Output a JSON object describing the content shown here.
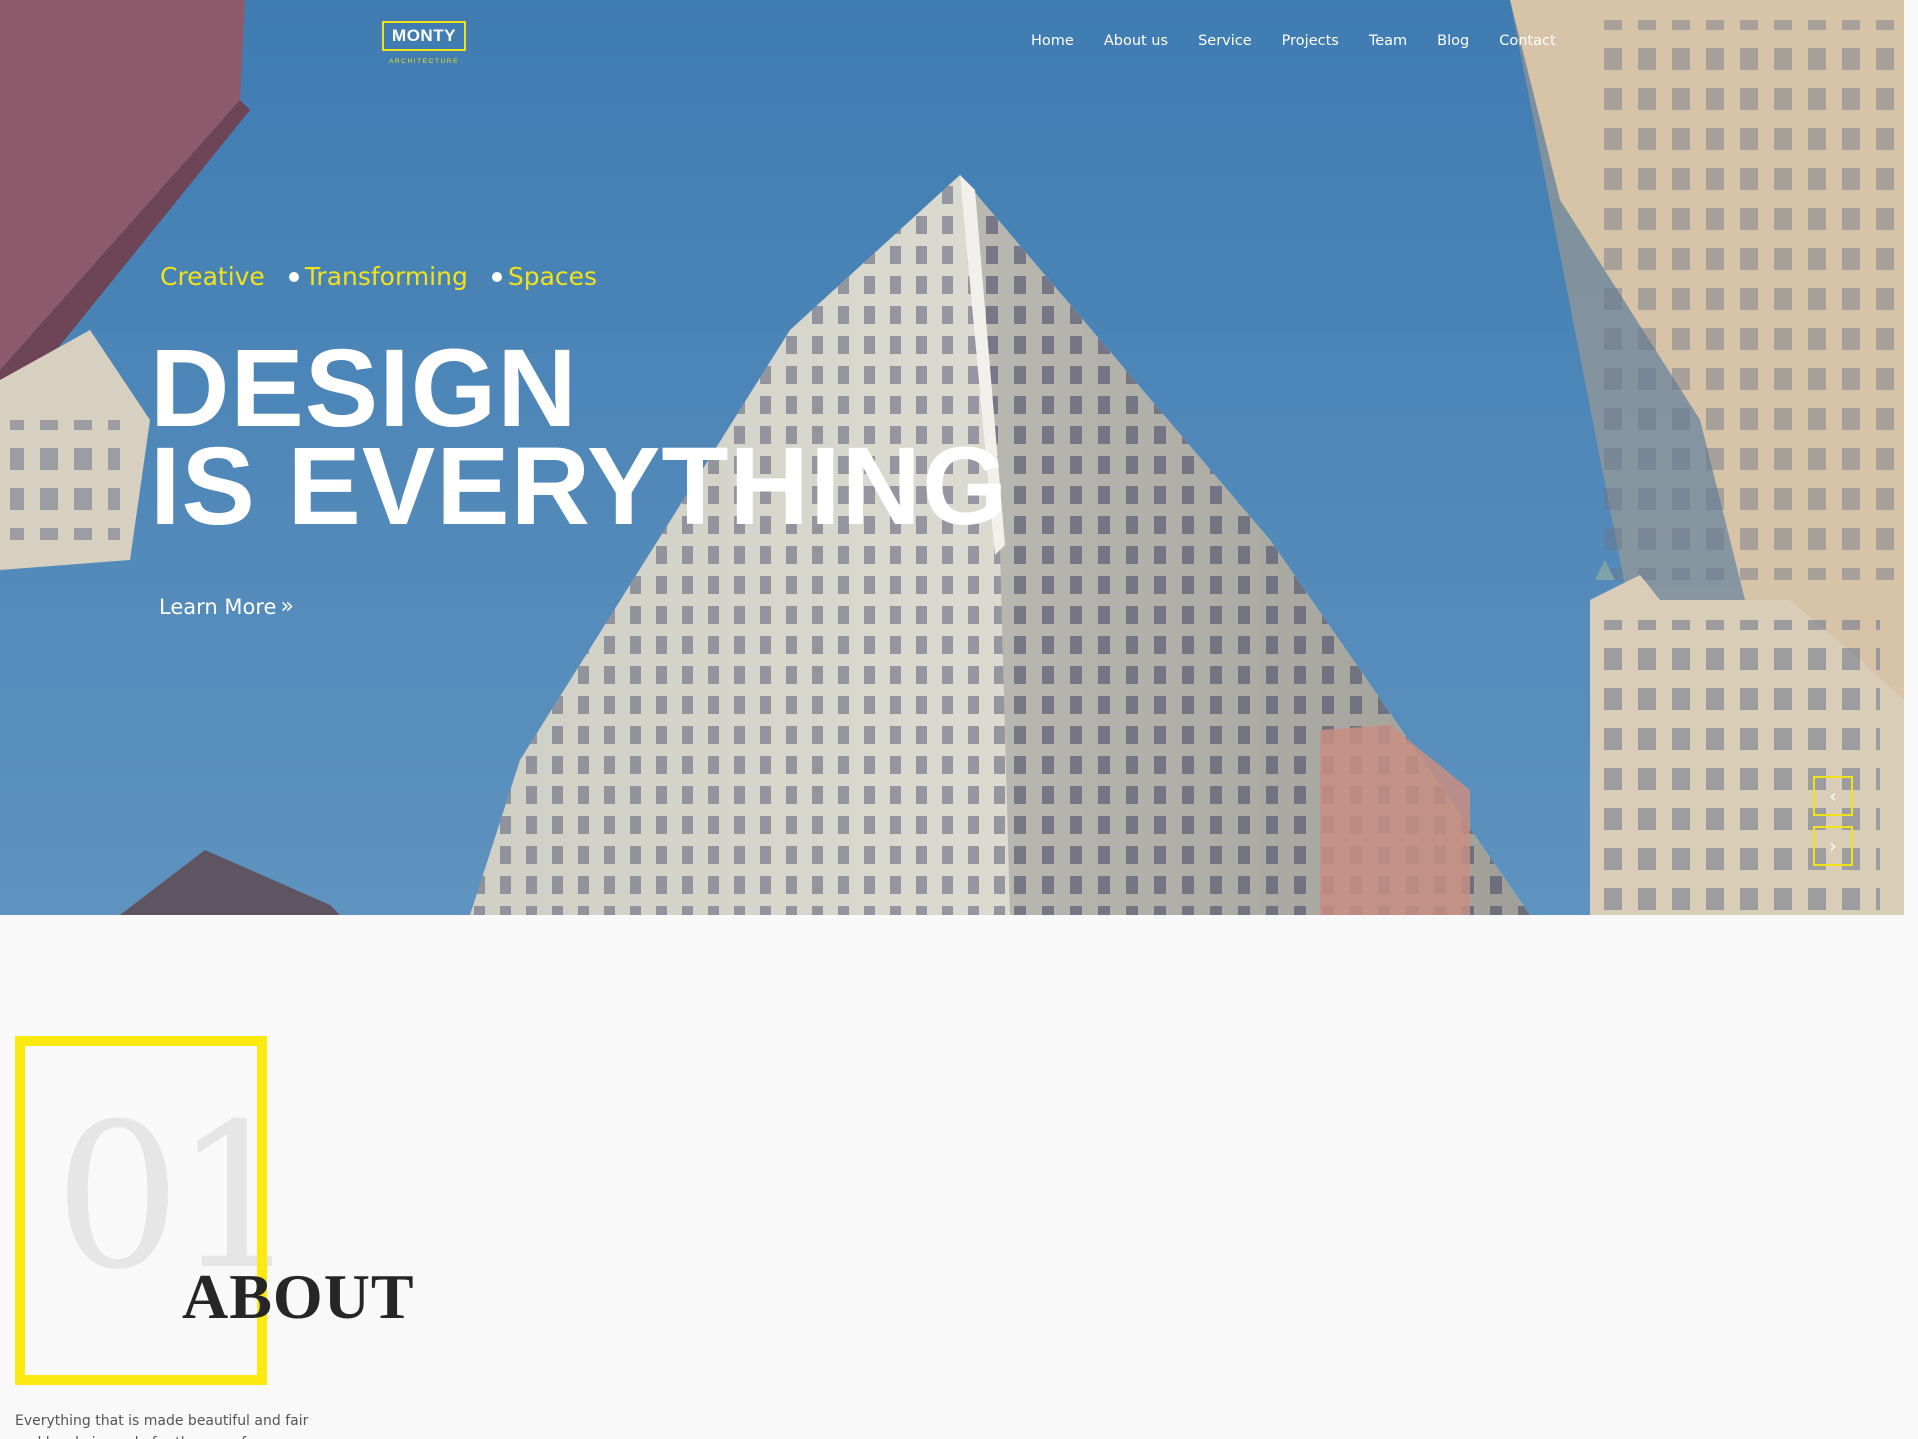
{
  "header": {
    "logo": {
      "text": "MONTY",
      "subtitle": "ARCHITECTURE"
    },
    "nav": [
      {
        "label": "Home"
      },
      {
        "label": "About us"
      },
      {
        "label": "Service"
      },
      {
        "label": "Projects"
      },
      {
        "label": "Team"
      },
      {
        "label": "Blog"
      },
      {
        "label": "Contact"
      }
    ]
  },
  "hero": {
    "tagline": [
      "Creative",
      "Transforming",
      "Spaces"
    ],
    "headline_line1": "DESIGN",
    "headline_line2": "IS EVERYTHING",
    "cta_label": "Learn More",
    "cta_icon": "»",
    "prev_icon": "‹",
    "next_icon": "›"
  },
  "about": {
    "number": "01",
    "title": "ABOUT",
    "text": "Everything that is made beautiful and fair and lovely is made for the eye of one"
  },
  "colors": {
    "accent": "#f1e21c",
    "about_frame": "#fbe90f",
    "sky": "#4a88bb",
    "page_bg": "#f9f9f9"
  }
}
